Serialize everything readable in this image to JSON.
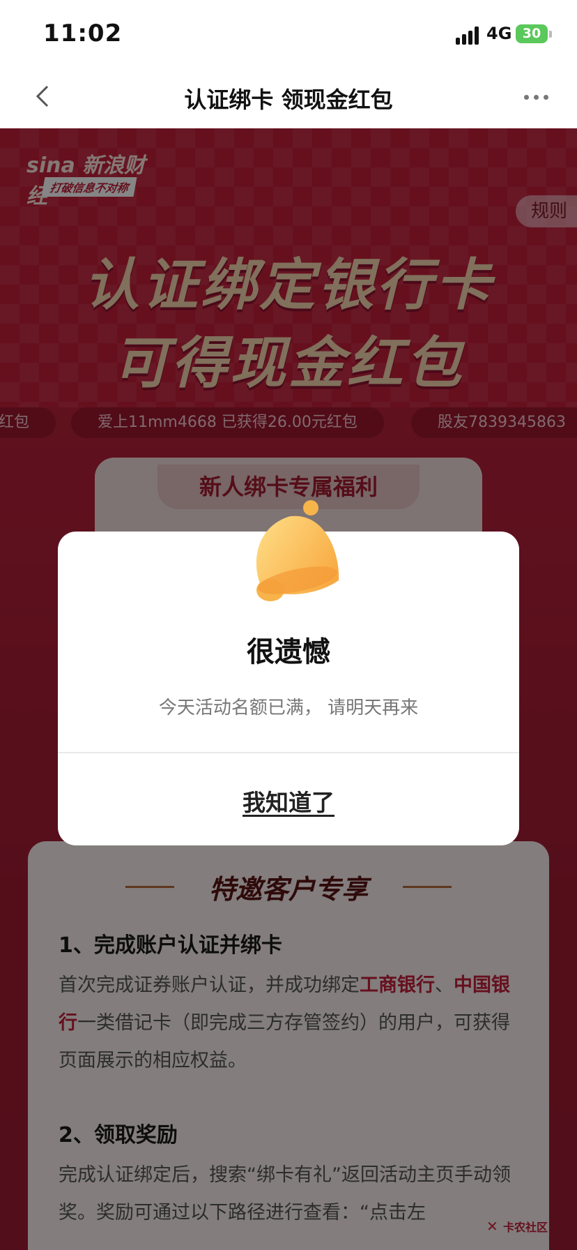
{
  "status_bar": {
    "time": "11:02",
    "network": "4G",
    "battery": "30"
  },
  "nav": {
    "title": "认证绑卡 领现金红包"
  },
  "brand": {
    "name": "新浪财经",
    "slogan": "打破信息不对称"
  },
  "rules_tab": "规则",
  "headline": {
    "line1": "认证绑定银行卡",
    "line2": "可得现金红包"
  },
  "ticker": [
    "红包",
    "爱上11mm4668 已获得26.00元红包",
    "股友7839345863"
  ],
  "benefit_title": "新人绑卡专属福利",
  "rules": {
    "heading": "特邀客户专享",
    "sections": [
      {
        "title": "1、完成账户认证并绑卡",
        "body_parts": [
          "首次完成证券账户认证，并成功绑定",
          "工商银行",
          "、",
          "中国银行",
          "一类借记卡（即完成三方存管签约）的用户，可获得页面展示的相应权益。"
        ]
      },
      {
        "title": "2、领取奖励",
        "body": "完成认证绑定后，搜索“绑卡有礼”返回活动主页手动领奖。奖励可通过以下路径进行查看：“点击左"
      }
    ]
  },
  "watermark": "卡农社区",
  "dialog": {
    "title": "很遗憾",
    "message": "今天活动名额已满， 请明天再来",
    "button": "我知道了"
  },
  "colors": {
    "brand_red": "#c41f3b",
    "battery_green": "#5ac85a"
  }
}
